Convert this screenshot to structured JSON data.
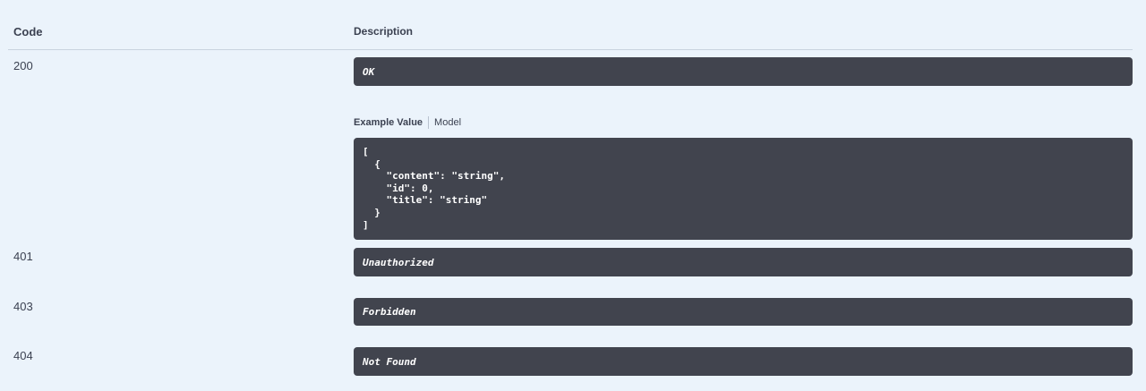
{
  "headers": {
    "code": "Code",
    "description": "Description"
  },
  "responses": [
    {
      "code": "200",
      "description": "OK"
    },
    {
      "code": "401",
      "description": "Unauthorized"
    },
    {
      "code": "403",
      "description": "Forbidden"
    },
    {
      "code": "404",
      "description": "Not Found"
    }
  ],
  "example_tabs": {
    "example_value": "Example Value",
    "model": "Model"
  },
  "example_value": "[\n  {\n    \"content\": \"string\",\n    \"id\": 0,\n    \"title\": \"string\"\n  }\n]"
}
